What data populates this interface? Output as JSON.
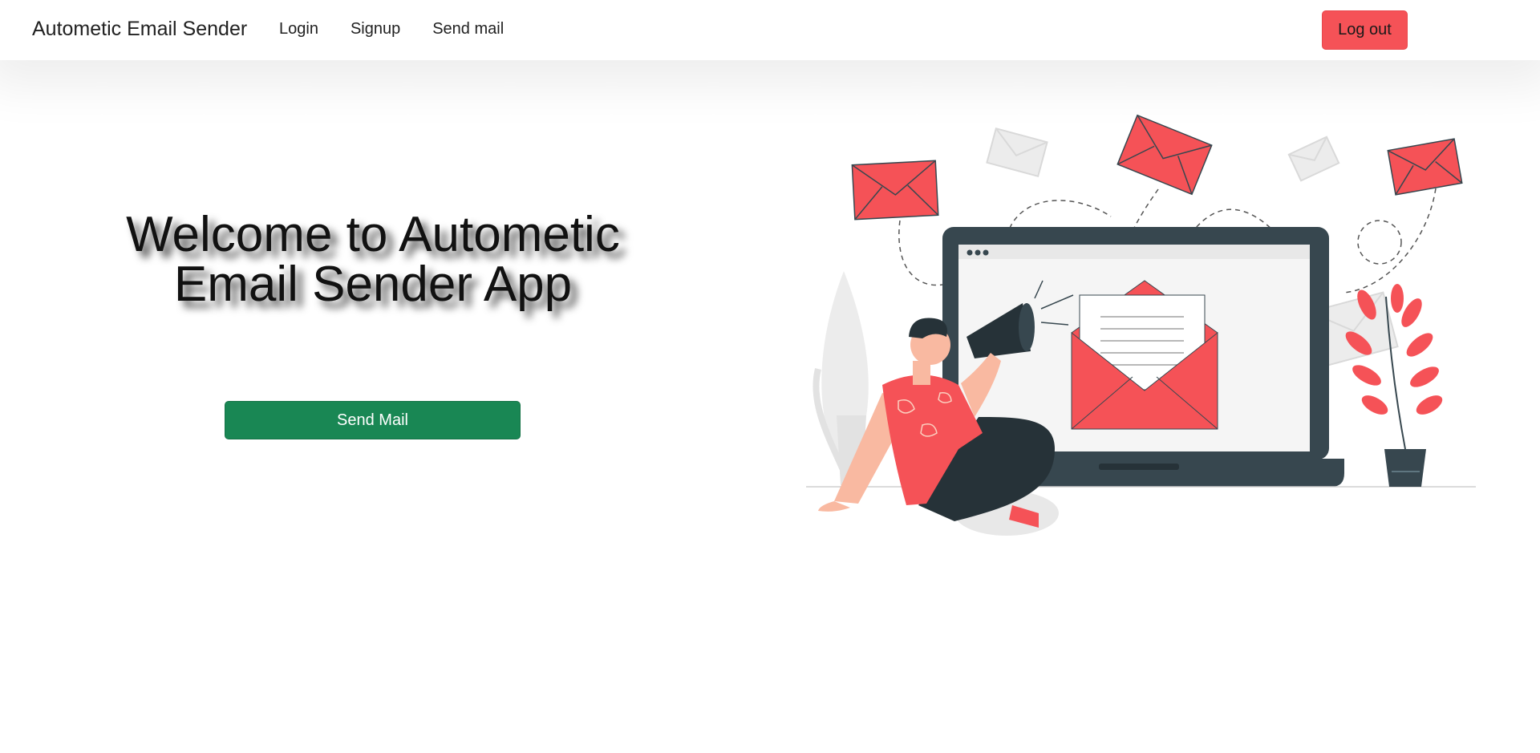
{
  "navbar": {
    "brand": "Autometic Email Sender",
    "links": [
      "Login",
      "Signup",
      "Send mail"
    ],
    "logout_label": "Log out"
  },
  "hero": {
    "title": "Welcome to Autometic Email Sender App",
    "send_button_label": "Send Mail"
  },
  "illustration": {
    "subject": "man with megaphone sitting by laptop showing an email envelope, with flying envelopes and potted plants",
    "colors": {
      "accent": "#f55257",
      "dark": "#37474f",
      "skin": "#f9b9a1"
    }
  },
  "colors": {
    "logout_bg": "#f55257",
    "send_bg": "#198754"
  }
}
